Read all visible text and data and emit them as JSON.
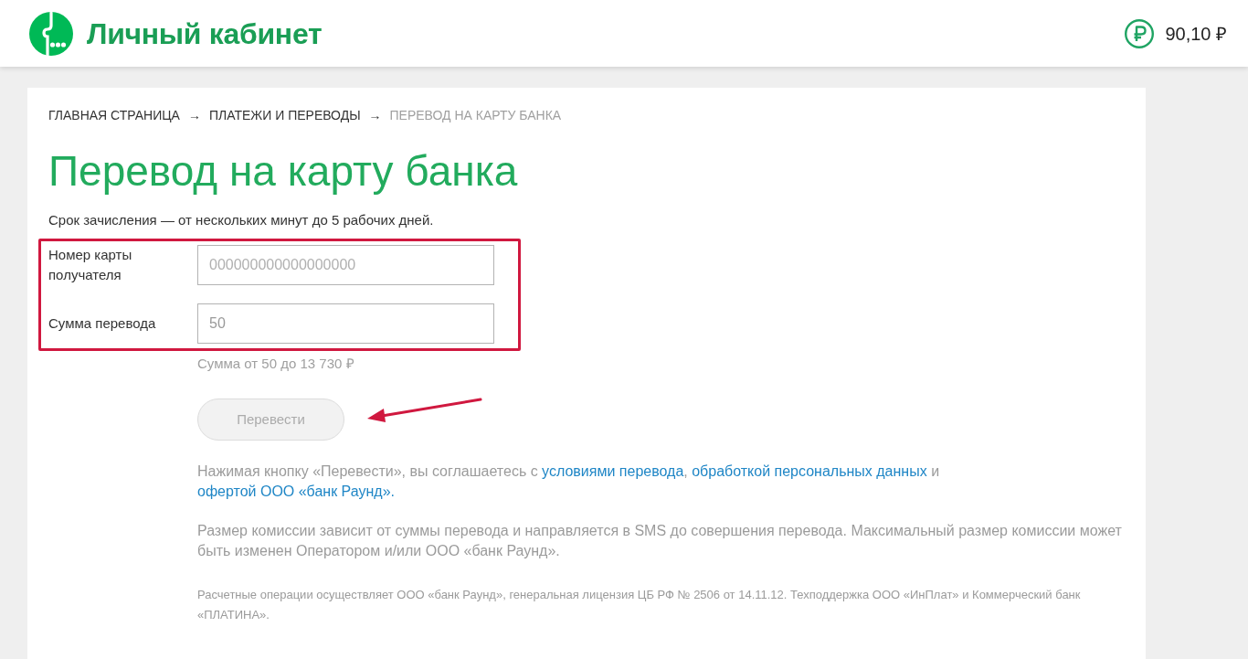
{
  "header": {
    "logo_text": "Личный кабинет",
    "balance": "90,10 ₽"
  },
  "breadcrumb": {
    "items": [
      {
        "label": "ГЛАВНАЯ СТРАНИЦА",
        "current": false
      },
      {
        "label": "ПЛАТЕЖИ И ПЕРЕВОДЫ",
        "current": false
      },
      {
        "label": "ПЕРЕВОД НА КАРТУ БАНКА",
        "current": true
      }
    ],
    "separators": [
      "→",
      "→"
    ]
  },
  "title": "Перевод на карту банка",
  "subtitle": "Срок зачисления — от нескольких минут до 5 рабочих дней.",
  "form": {
    "fields": [
      {
        "label": "Номер карты получателя",
        "placeholder": "000000000000000000"
      },
      {
        "label": "Сумма перевода",
        "placeholder": "50"
      }
    ],
    "hint": "Сумма от 50 до 13 730 ₽",
    "submit": {
      "label": "Перевести",
      "disabled": true
    }
  },
  "annotations": {
    "highlight_frame": true,
    "pointer_arrow": true
  },
  "notes": [
    {
      "kind": "links",
      "parts": [
        {
          "kind": "text",
          "text": "Нажимая кнопку «Перевести», вы соглашаетесь с "
        },
        {
          "kind": "link",
          "text": "условиями перевода"
        },
        {
          "kind": "text",
          "text": ", "
        },
        {
          "kind": "link",
          "text": "обработкой персональных данных"
        },
        {
          "kind": "text",
          "text": " и "
        },
        {
          "kind": "link",
          "text": "офертой ООО «банк Раунд»."
        }
      ]
    },
    {
      "kind": "plain",
      "text": "Размер комиссии зависит от суммы перевода и направляется в SMS до совершения перевода. Максимальный размер комиссии может быть изменен Оператором и/или ООО «банк Раунд»."
    },
    {
      "kind": "fine",
      "text": "Расчетные операции осуществляет ООО «банк Раунд», генеральная лицензия ЦБ РФ № 2506 от 14.11.12. Техподдержка ООО «ИнПлат» и Коммерческий банк «ПЛАТИНА»."
    }
  ]
}
